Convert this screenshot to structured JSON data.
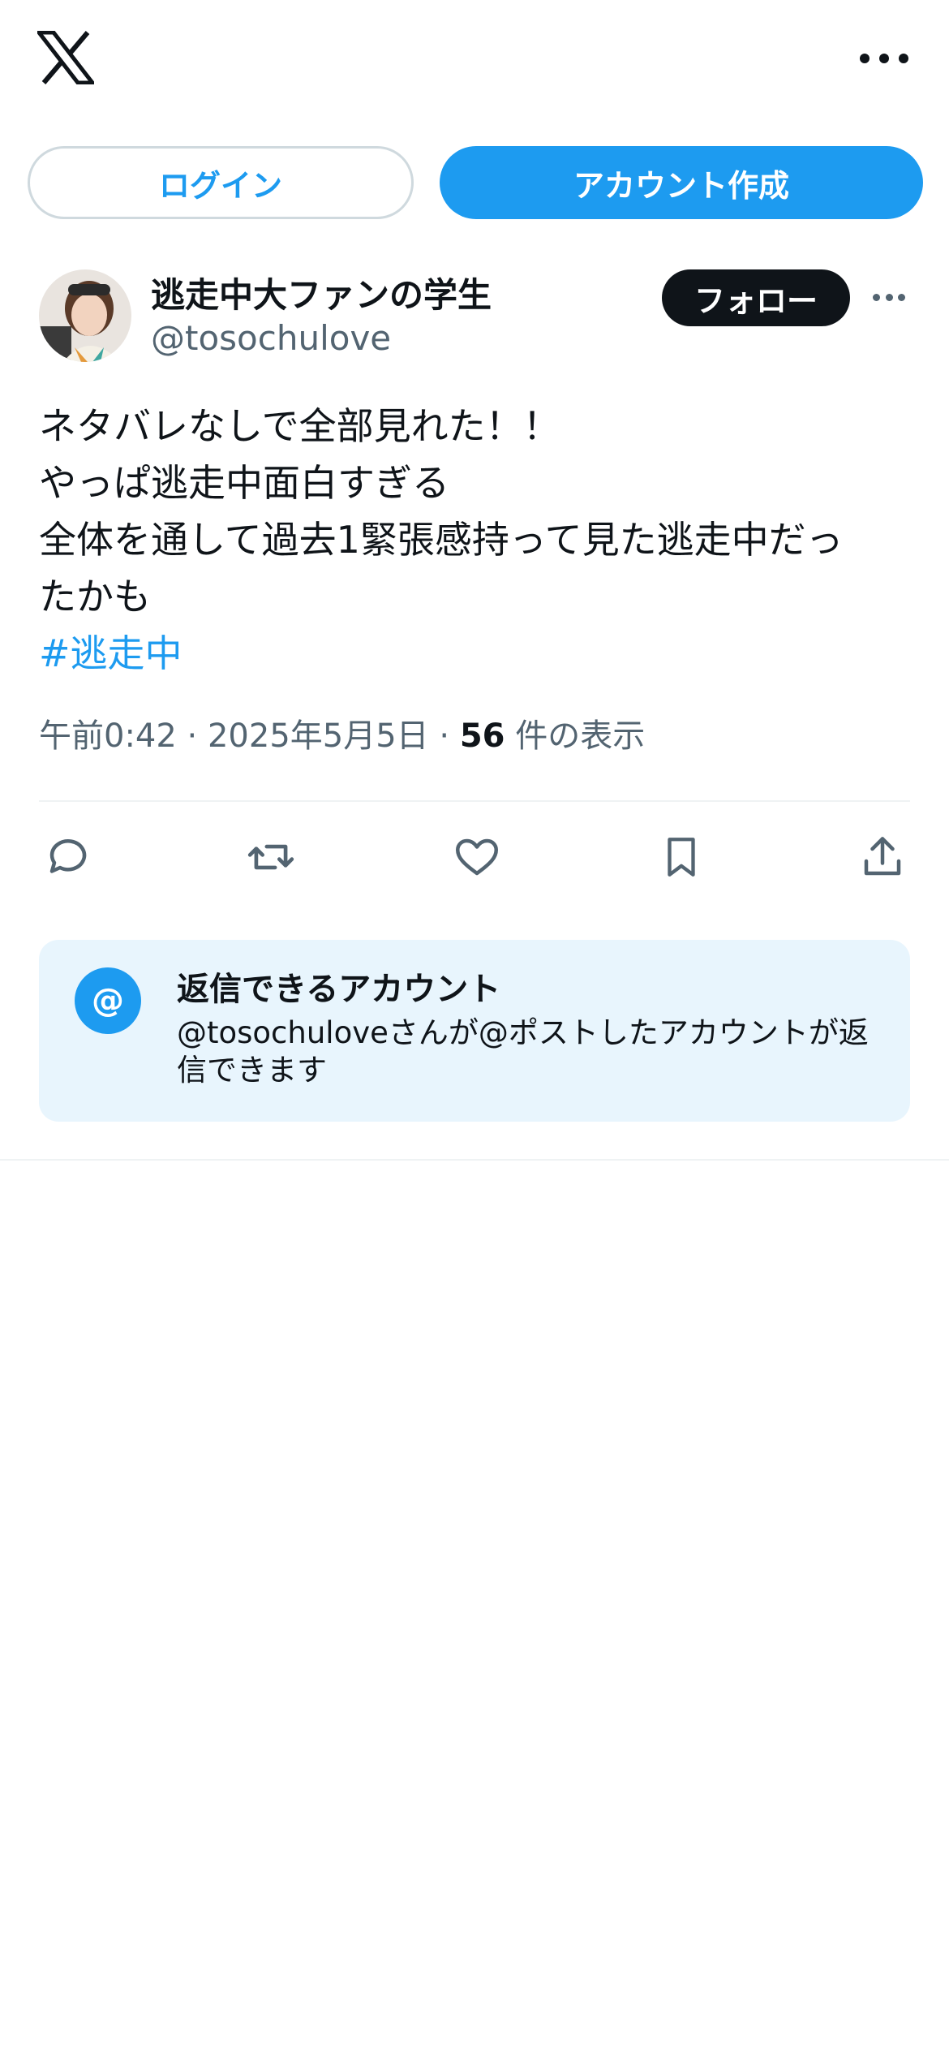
{
  "header": {
    "logo_icon": "x-logo-icon",
    "more_icon": "more-horizontal-icon"
  },
  "auth": {
    "login_label": "ログイン",
    "signup_label": "アカウント作成"
  },
  "post": {
    "author": {
      "display_name": "逃走中大ファンの学生",
      "handle": "@tosochulove"
    },
    "follow_label": "フォロー",
    "text_lines": [
      "ネタバレなしで全部見れた！！",
      "やっぱ逃走中面白すぎる",
      "全体を通して過去1緊張感持って見た逃走中だっ",
      "たかも"
    ],
    "hashtag": "#逃走中",
    "time": "午前0:42",
    "separator": "·",
    "date": "2025年5月5日",
    "views_count": "56",
    "views_label": "件の表示",
    "actions": [
      "reply-icon",
      "repost-icon",
      "like-icon",
      "bookmark-icon",
      "share-icon"
    ]
  },
  "reply_restriction": {
    "badge": "@",
    "title": "返信できるアカウント",
    "description": "@tosochuloveさんが@ポストしたアカウントが返信できます"
  },
  "colors": {
    "accent": "#1d9bf0",
    "text": "#0f1419",
    "muted": "#536471",
    "reply_box_bg": "#e8f5fd"
  }
}
